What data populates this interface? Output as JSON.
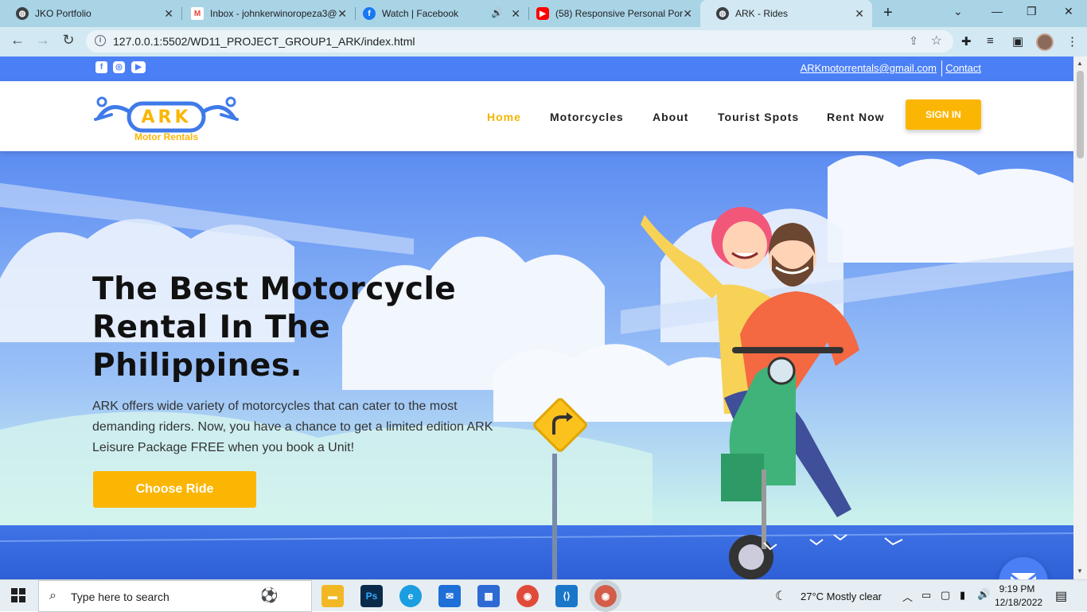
{
  "browser": {
    "tabs": [
      {
        "title": "JKO Portfolio",
        "icon": "globe-icon"
      },
      {
        "title": "Inbox - johnkerwinoropeza3@",
        "icon": "gmail-icon"
      },
      {
        "title": "Watch | Facebook",
        "icon": "facebook-icon"
      },
      {
        "title": "(58) Responsive Personal Por",
        "icon": "youtube-icon"
      },
      {
        "title": "ARK - Rides",
        "icon": "globe-icon"
      }
    ],
    "url": "127.0.0.1:5502/WD11_PROJECT_GROUP1_ARK/index.html"
  },
  "topbar": {
    "email": "ARKmotorrentals@gmail.com",
    "contact": "Contact",
    "socials": [
      "facebook-icon",
      "instagram-icon",
      "youtube-icon"
    ]
  },
  "nav": {
    "logo_text": "ARK",
    "logo_sub": "Motor Rentals",
    "links": [
      "Home",
      "Motorcycles",
      "About",
      "Tourist Spots",
      "Rent Now"
    ],
    "active": "Home",
    "signin": "SIGN IN"
  },
  "hero": {
    "headline_1": "The Best Motorcycle",
    "headline_2": "Rental In The",
    "headline_3": "Philippines.",
    "lead": "ARK offers wide variety of motorcycles that can cater to the most demanding riders. Now, you have a chance to get a limited edition ARK Leisure Package FREE when you book a Unit!",
    "cta": "Choose Ride"
  },
  "taskbar": {
    "search_placeholder": "Type here to search",
    "weather": "27°C  Mostly clear",
    "time": "9:19 PM",
    "date": "12/18/2022"
  },
  "colors": {
    "accent": "#fbb604",
    "primary": "#4b7ff6"
  }
}
